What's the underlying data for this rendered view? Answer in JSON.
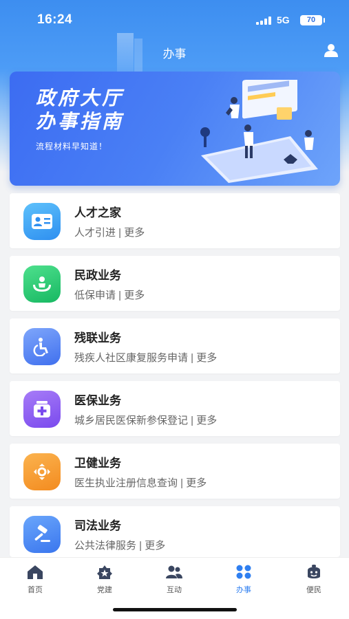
{
  "status": {
    "time": "16:24",
    "network": "5G",
    "battery": "70"
  },
  "header": {
    "title": "办事"
  },
  "banner": {
    "title_line1": "政府大厅",
    "title_line2": "办事指南",
    "subtitle": "流程材料早知道！"
  },
  "services": [
    {
      "title": "人才之家",
      "subtitle": "人才引进 | 更多",
      "icon": "id-card-icon",
      "color": "#2e9cf5"
    },
    {
      "title": "民政业务",
      "subtitle": "低保申请 | 更多",
      "icon": "care-hands-icon",
      "color": "#1fc16b"
    },
    {
      "title": "残联业务",
      "subtitle": "残疾人社区康复服务申请 | 更多",
      "icon": "wheelchair-icon",
      "color": "#4a7bf2"
    },
    {
      "title": "医保业务",
      "subtitle": "城乡居民医保新参保登记 | 更多",
      "icon": "medicine-box-icon",
      "color": "#8a5cf0"
    },
    {
      "title": "卫健业务",
      "subtitle": "医生执业注册信息查询 | 更多",
      "icon": "health-icon",
      "color": "#f59a2a"
    },
    {
      "title": "司法业务",
      "subtitle": "公共法律服务 | 更多",
      "icon": "gavel-icon",
      "color": "#3d86f2"
    }
  ],
  "tabs": [
    {
      "label": "首页",
      "icon": "home-icon"
    },
    {
      "label": "党建",
      "icon": "party-icon"
    },
    {
      "label": "互动",
      "icon": "people-icon"
    },
    {
      "label": "办事",
      "icon": "grid-icon",
      "active": true
    },
    {
      "label": "便民",
      "icon": "smile-icon"
    }
  ],
  "colors": {
    "primary": "#2f7ff0",
    "banner": "#3c6cf2"
  }
}
